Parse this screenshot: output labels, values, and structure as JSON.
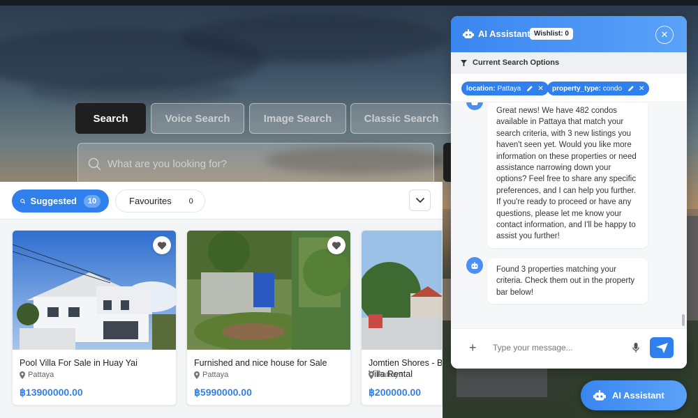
{
  "search_tabs": [
    {
      "label": "Search",
      "active": true
    },
    {
      "label": "Voice Search",
      "active": false
    },
    {
      "label": "Image Search",
      "active": false
    },
    {
      "label": "Classic Search",
      "active": false
    }
  ],
  "search": {
    "placeholder": "What are you looking for?"
  },
  "filters": {
    "suggested": {
      "label": "Suggested",
      "count": "10"
    },
    "favourites": {
      "label": "Favourites",
      "count": "0"
    }
  },
  "listings": [
    {
      "title": "Pool Villa For Sale in Huay Yai",
      "location": "Pattaya",
      "price": "฿13900000.00"
    },
    {
      "title": "Furnished and nice house for Sale",
      "location": "Pattaya",
      "price": "฿5990000.00"
    },
    {
      "title": "Jomtien Shores - B Villa Rental",
      "location": "Pattaya",
      "price": "฿200000.00"
    }
  ],
  "chat": {
    "title": "AI Assistant",
    "wishlist": "Wishlist: 0",
    "options_label": "Current Search Options",
    "tags": [
      {
        "key": "location:",
        "value": "Pattaya"
      },
      {
        "key": "property_type:",
        "value": "condo"
      }
    ],
    "messages": [
      {
        "text": "Great news! We have 482 condos available in Pattaya that match your search criteria, with 3 new listings you haven't seen yet. Would you like more information on these properties or need assistance narrowing down your options? Feel free to share any specific preferences, and I can help you further. If you're ready to proceed or have any questions, please let me know your contact information, and I'll be happy to assist you further!"
      },
      {
        "text": "Found 3 properties matching your criteria. Check them out in the property bar below!"
      }
    ],
    "input_placeholder": "Type your message..."
  },
  "fab": {
    "label": "AI Assistant"
  },
  "colors": {
    "accent": "#2f80ed",
    "dark_tab": "#1f1f1f"
  }
}
